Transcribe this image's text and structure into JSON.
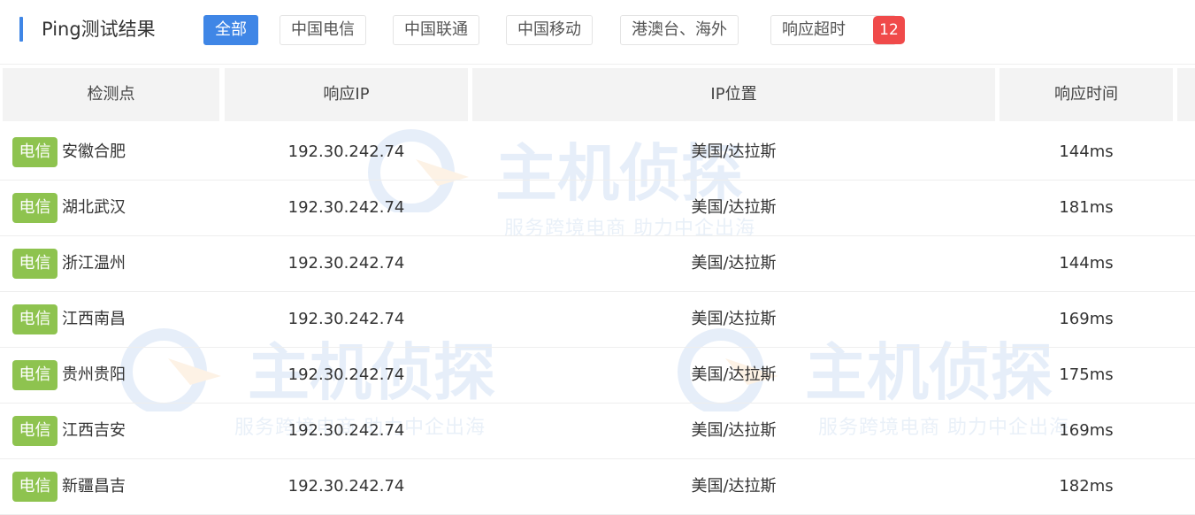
{
  "header": {
    "title": "Ping测试结果",
    "tabs": [
      {
        "label": "全部",
        "active": true
      },
      {
        "label": "中国电信",
        "active": false
      },
      {
        "label": "中国联通",
        "active": false
      },
      {
        "label": "中国移动",
        "active": false
      },
      {
        "label": "港澳台、海外",
        "active": false
      },
      {
        "label": "响应超时",
        "active": false
      }
    ],
    "timeout_count": "12"
  },
  "table": {
    "columns": [
      "检测点",
      "响应IP",
      "IP位置",
      "响应时间"
    ],
    "rows": [
      {
        "isp": "电信",
        "node": "安徽合肥",
        "ip": "192.30.242.74",
        "location": "美国/达拉斯",
        "time": "144ms"
      },
      {
        "isp": "电信",
        "node": "湖北武汉",
        "ip": "192.30.242.74",
        "location": "美国/达拉斯",
        "time": "181ms"
      },
      {
        "isp": "电信",
        "node": "浙江温州",
        "ip": "192.30.242.74",
        "location": "美国/达拉斯",
        "time": "144ms"
      },
      {
        "isp": "电信",
        "node": "江西南昌",
        "ip": "192.30.242.74",
        "location": "美国/达拉斯",
        "time": "169ms"
      },
      {
        "isp": "电信",
        "node": "贵州贵阳",
        "ip": "192.30.242.74",
        "location": "美国/达拉斯",
        "time": "175ms"
      },
      {
        "isp": "电信",
        "node": "江西吉安",
        "ip": "192.30.242.74",
        "location": "美国/达拉斯",
        "time": "169ms"
      },
      {
        "isp": "电信",
        "node": "新疆昌吉",
        "ip": "192.30.242.74",
        "location": "美国/达拉斯",
        "time": "182ms"
      }
    ]
  },
  "watermark": {
    "brand": "主机侦探",
    "slogan": "服务跨境电商 助力中企出海"
  },
  "colors": {
    "accent": "#3f86e6",
    "isp_tag": "#8ec34f",
    "badge": "#f04a4a"
  }
}
